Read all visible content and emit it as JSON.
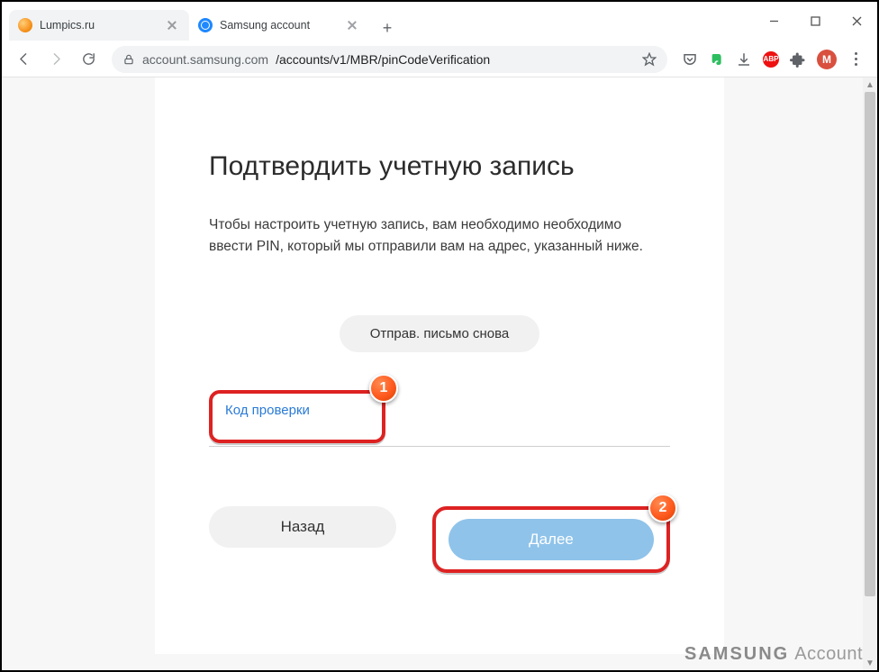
{
  "tabs": [
    {
      "title": "Lumpics.ru"
    },
    {
      "title": "Samsung account"
    }
  ],
  "url": {
    "host": "account.samsung.com",
    "path": "/accounts/v1/MBR/pinCodeVerification"
  },
  "page": {
    "heading": "Подтвердить учетную запись",
    "description_l1": "Чтобы настроить учетную запись, вам необходимо необходимо",
    "description_l2": "ввести PIN, который мы отправили вам на адрес, указанный ниже.",
    "resend_label": "Отправ. письмо снова",
    "code_label": "Код проверки",
    "back_label": "Назад",
    "next_label": "Далее"
  },
  "annotations": {
    "b1": "1",
    "b2": "2"
  },
  "avatar_initial": "M",
  "brand": {
    "logo": "SAMSUNG",
    "text": "Account"
  },
  "ext": {
    "abp": "ABP"
  }
}
